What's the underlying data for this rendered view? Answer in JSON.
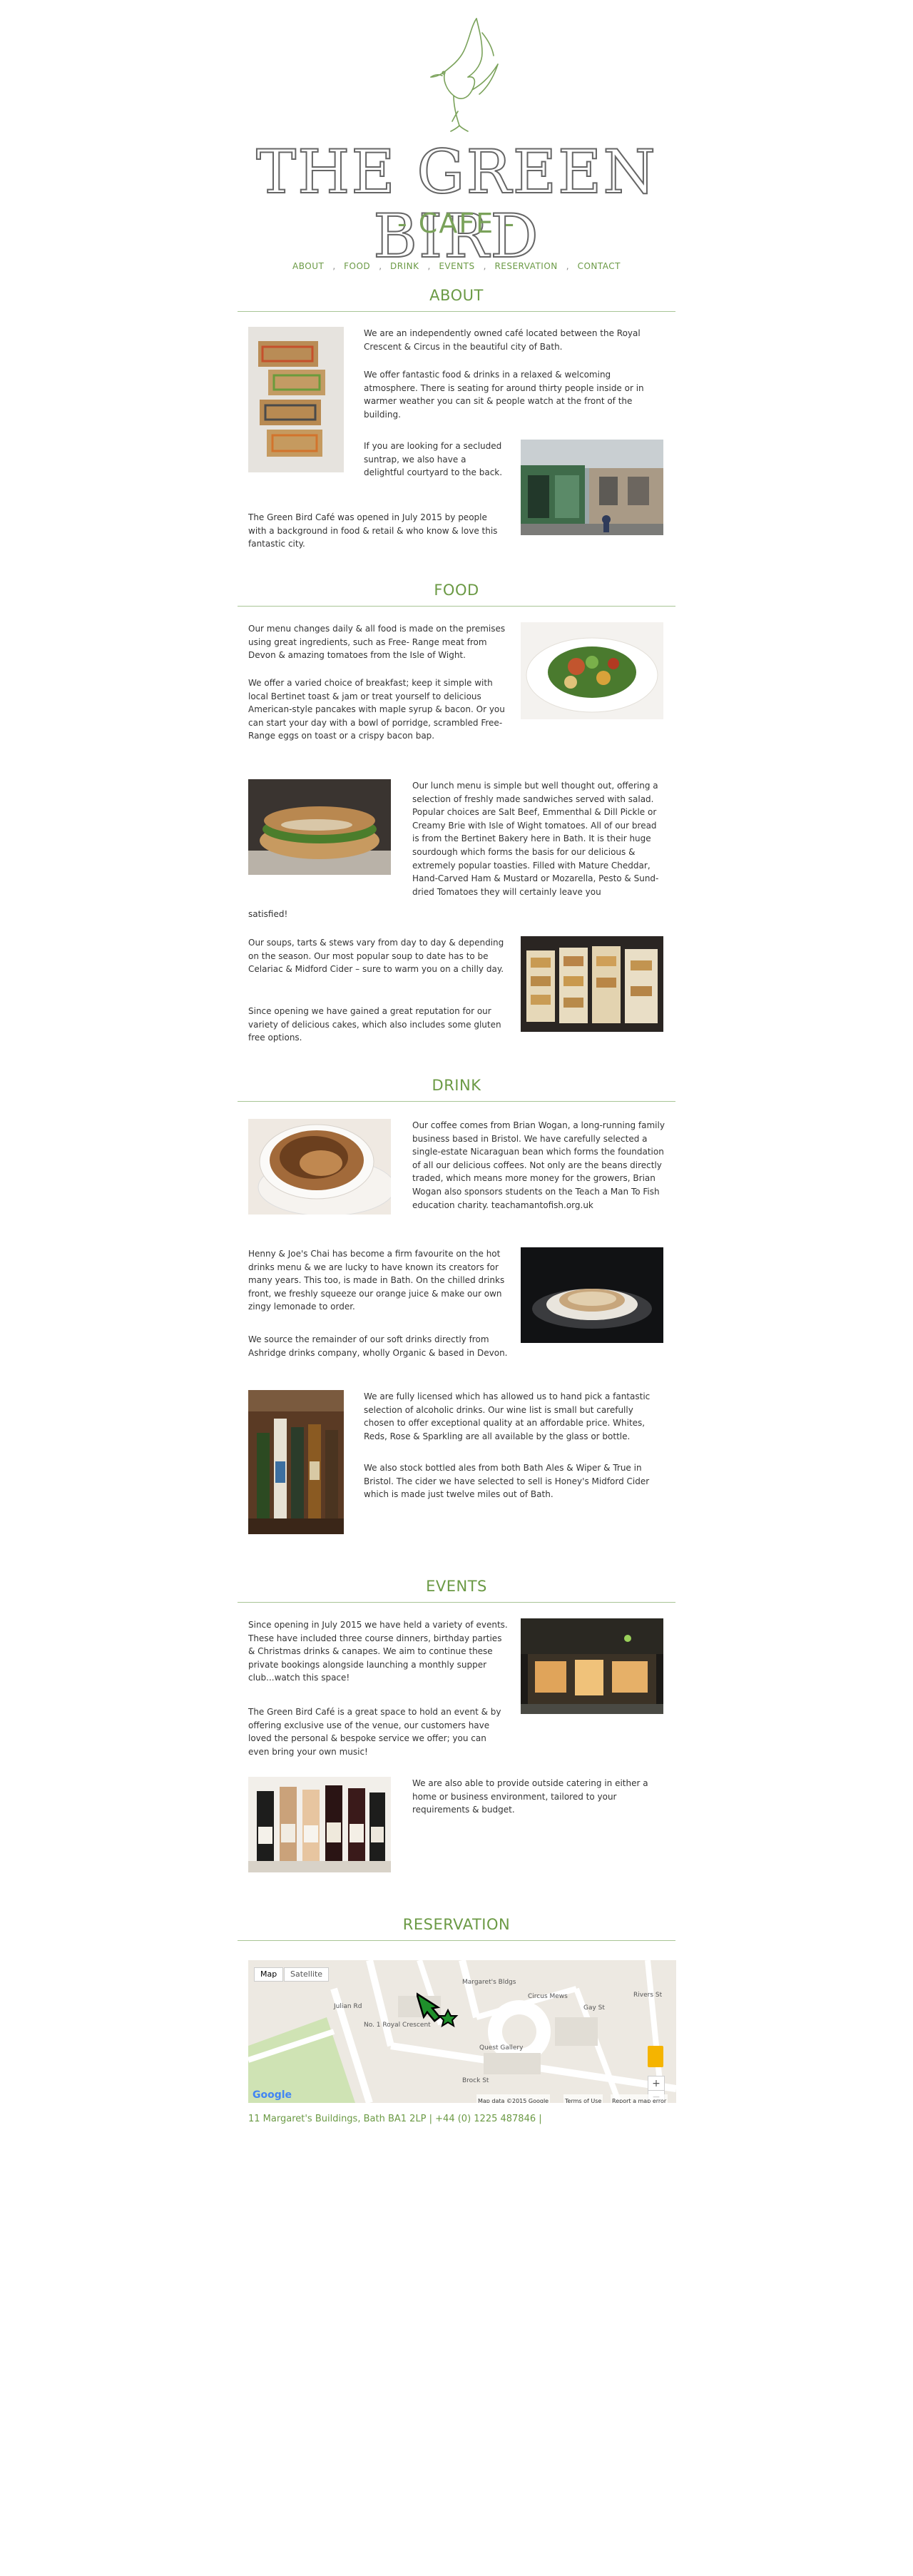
{
  "brand": {
    "title": "THE GREEN BIRD",
    "subtitle": "- CAFE -",
    "accent_color": "#6b9a45",
    "bird_icon": "bird-icon"
  },
  "nav": {
    "items": [
      "ABOUT",
      "FOOD",
      "DRINK",
      "EVENTS",
      "RESERVATION",
      "CONTACT"
    ],
    "separator": ","
  },
  "about": {
    "heading": "ABOUT",
    "p1": "We are an independently owned café located between the Royal Crescent & Circus in the beautiful city of Bath.",
    "p2": "We offer fantastic food & drinks in a relaxed & welcoming atmosphere. There is seating for around thirty people inside or in warmer weather you can sit & people watch at the front of the building.",
    "p3": "If you are looking for a secluded suntrap, we also have a delightful courtyard to the back.",
    "p4": "The Green Bird Café was opened in July 2015 by people with a background in food & retail & who know & love this fantastic city."
  },
  "food": {
    "heading": "FOOD",
    "p1": "Our menu changes daily & all food is made on the premises using great ingredients, such as Free- Range meat from Devon & amazing tomatoes from the Isle of Wight.",
    "p2": "We offer a varied choice of breakfast; keep it simple with local Bertinet toast & jam or treat yourself to delicious American-style pancakes with maple syrup & bacon. Or you can start your day with a bowl of porridge, scrambled Free-Range eggs on toast or a crispy bacon bap.",
    "p3": "Our lunch menu is simple but well thought out, offering a selection of freshly made sandwiches served with salad. Popular choices are Salt Beef, Emmenthal & Dill Pickle or Creamy Brie with Isle of Wight tomatoes. All of our bread is from the Bertinet Bakery here in Bath. It is their huge sourdough which forms the basis for our delicious & extremely popular toasties. Filled with Mature Cheddar, Hand-Carved Ham & Mustard or Mozarella, Pesto & Sund-dried Tomatoes they will certainly leave you",
    "p3b": "satisfied!",
    "p4": "Our soups, tarts & stews vary from day to day & depending on the season. Our most popular soup to date has to be Celariac & Midford Cider – sure to warm you on a chilly day.",
    "p5": "Since opening we have gained a great reputation for our variety of delicious cakes, which also includes some gluten free options."
  },
  "drink": {
    "heading": "DRINK",
    "p1": "Our coffee comes from Brian Wogan, a long-running family business based in Bristol. We have carefully selected a single-estate Nicaraguan bean which forms the foundation of all our delicious coffees. Not only are the beans directly traded, which means more money for the growers, Brian Wogan also sponsors students on the Teach a Man To Fish education charity. teachamantofish.org.uk",
    "p2": "Henny & Joe's Chai has become a firm favourite on the hot drinks menu & we are lucky to have known its creators for many years. This too, is made in Bath. On the chilled drinks front, we freshly squeeze our orange juice & make our own zingy lemonade to order.",
    "p3": "We source the remainder of our soft drinks directly from Ashridge drinks company, wholly Organic & based in Devon.",
    "p4": "We are fully licensed which has allowed us to hand pick a fantastic selection of alcoholic drinks. Our wine list is small but carefully chosen to offer exceptional quality at an affordable price. Whites, Reds, Rose & Sparkling are all available by the glass or bottle.",
    "p5": "We also stock bottled ales from both Bath Ales & Wiper & True in Bristol. The cider we have selected to sell is Honey's Midford Cider which is made just twelve miles out of Bath."
  },
  "events": {
    "heading": "EVENTS",
    "p1": "Since opening in July 2015 we have held a variety of events. These have included three course dinners, birthday parties & Christmas drinks & canapes. We aim to continue these private bookings alongside launching a monthly supper club...watch this space!",
    "p2": "The Green Bird Café is a great space to hold an event & by offering exclusive use of the venue, our customers have loved the personal & bespoke service we offer; you can even bring your own music!",
    "p3": "We are also able to provide outside catering in either a home or business environment, tailored to your requirements & budget."
  },
  "reservation": {
    "heading": "RESERVATION",
    "map": {
      "tab_map": "Map",
      "tab_satellite": "Satellite",
      "labels": [
        "No. 1 Royal Crescent",
        "Quest Gallery",
        "Circus Mews",
        "Brock St",
        "Margaret's Bldgs",
        "Rivers St",
        "Julian Rd",
        "Gay St"
      ],
      "attribution": "Map data ©2015 Google",
      "terms": "Terms of Use",
      "report": "Report a map error",
      "logo": "Google",
      "zoom_in": "+",
      "zoom_out": "−"
    }
  },
  "footer": {
    "address": "11 Margaret's Buildings, Bath BA1 2LP | +44 (0) 1225 487846 |"
  }
}
